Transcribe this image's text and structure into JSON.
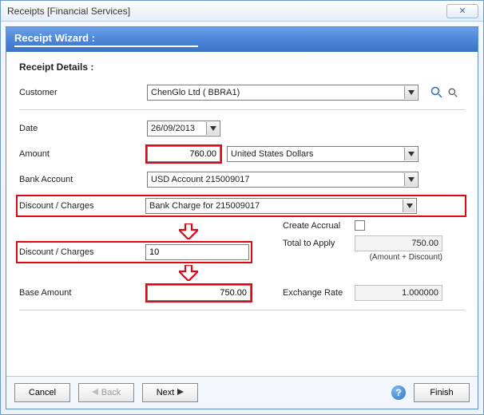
{
  "window": {
    "title": "Receipts [Financial Services]"
  },
  "wizard": {
    "title": "Receipt Wizard :"
  },
  "section": {
    "title": "Receipt Details :"
  },
  "labels": {
    "customer": "Customer",
    "date": "Date",
    "amount": "Amount",
    "bank_account": "Bank Account",
    "discount_charges": "Discount / Charges",
    "create_accrual": "Create Accrual",
    "total_to_apply": "Total to Apply",
    "amount_plus_discount": "(Amount + Discount)",
    "base_amount": "Base Amount",
    "exchange_rate": "Exchange Rate"
  },
  "customer": {
    "value": "ChenGlo Ltd ( BBRA1)"
  },
  "date": {
    "value": "26/09/2013"
  },
  "amount": {
    "value": "760.00"
  },
  "currency": {
    "value": "United States Dollars"
  },
  "bank_account": {
    "value": "USD Account 215009017"
  },
  "discount_type": {
    "value": "Bank Charge for 215009017"
  },
  "discount_amount": {
    "value": "10"
  },
  "create_accrual": {
    "checked": false
  },
  "total_to_apply": {
    "value": "750.00"
  },
  "base_amount": {
    "value": "750.00"
  },
  "exchange_rate": {
    "value": "1.000000"
  },
  "buttons": {
    "cancel": "Cancel",
    "back": "Back",
    "next": "Next",
    "finish": "Finish"
  }
}
